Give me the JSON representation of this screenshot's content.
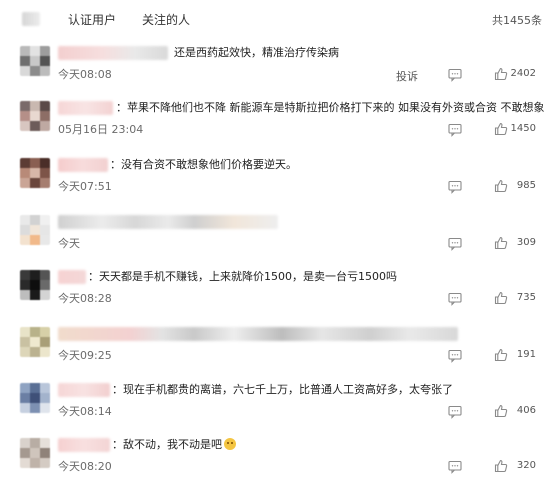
{
  "tabs": {
    "verified": "认证用户",
    "following": "关注的人"
  },
  "total": "共1455条",
  "actions": {
    "report": "投诉"
  },
  "comments": [
    {
      "text": "还是西药起效快，精准治疗传染病",
      "time": "今天08:08",
      "likes": "2402",
      "show_report": true
    },
    {
      "text": "：苹果不降他们也不降 新能源车是特斯拉把价格打下来的 如果没有外资或合资 不敢想象",
      "time": "05月16日 23:04",
      "likes": "1450",
      "show_report": false
    },
    {
      "text": "：没有合资不敢想象他们价格要逆天。",
      "time": "今天07:51",
      "likes": "985",
      "show_report": false
    },
    {
      "text": "",
      "time": "今天",
      "likes": "309",
      "show_report": false
    },
    {
      "text": "：天天都是手机不赚钱，上来就降价1500，是卖一台亏1500吗",
      "time": "今天08:28",
      "likes": "735",
      "show_report": false
    },
    {
      "text": "",
      "time": "今天09:25",
      "likes": "191",
      "show_report": false
    },
    {
      "text": "：现在手机都贵的离谱，六七千上万，比普通人工资高好多，太夸张了",
      "time": "今天08:14",
      "likes": "406",
      "show_report": false
    },
    {
      "text": "：敌不动，我不动是吧",
      "time": "今天08:20",
      "likes": "320",
      "show_report": false
    }
  ],
  "colors": {
    "text": "#333333",
    "muted": "#6b6b6b",
    "icon": "#8a8a8a"
  }
}
